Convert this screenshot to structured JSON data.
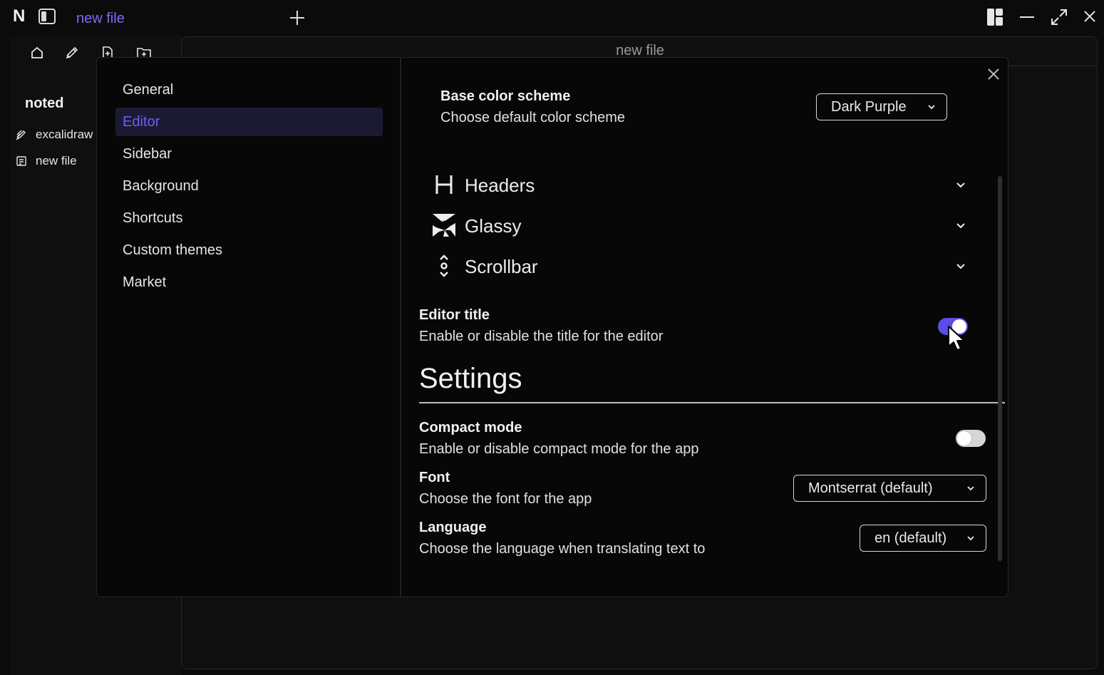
{
  "app": {
    "logo": "N",
    "tab_title": "new file"
  },
  "sidebar": {
    "workspace": "noted",
    "files": [
      {
        "name": "excalidraw",
        "icon": "pen-icon"
      },
      {
        "name": "new file",
        "icon": "note-icon"
      }
    ],
    "tools": [
      "home-icon",
      "edit-icon",
      "new-file-icon",
      "new-folder-icon"
    ]
  },
  "editor": {
    "title": "new file"
  },
  "settings_modal": {
    "nav": [
      {
        "label": "General",
        "active": false
      },
      {
        "label": "Editor",
        "active": true
      },
      {
        "label": "Sidebar",
        "active": false
      },
      {
        "label": "Background",
        "active": false
      },
      {
        "label": "Shortcuts",
        "active": false
      },
      {
        "label": "Custom themes",
        "active": false
      },
      {
        "label": "Market",
        "active": false
      }
    ],
    "base_color": {
      "title": "Base color scheme",
      "desc": "Choose default color scheme",
      "value": "Dark Purple"
    },
    "accordions": [
      {
        "label": "Headers",
        "icon": "heading-icon"
      },
      {
        "label": "Glassy",
        "icon": "glass-icon"
      },
      {
        "label": "Scrollbar",
        "icon": "scrollbar-icon"
      }
    ],
    "editor_title": {
      "title": "Editor title",
      "desc": "Enable or disable the title for the editor",
      "enabled": true
    },
    "heading": "Settings",
    "compact_mode": {
      "title": "Compact mode",
      "desc": "Enable or disable compact mode for the app",
      "enabled": false
    },
    "font": {
      "title": "Font",
      "desc": "Choose the font for the app",
      "value": "Montserrat (default)"
    },
    "language": {
      "title": "Language",
      "desc": "Choose the language when translating text to",
      "value": "en (default)"
    }
  },
  "colors": {
    "accent": "#6d5ef0",
    "toggle_on": "#5b4ee6",
    "background": "#0b0b0b"
  }
}
